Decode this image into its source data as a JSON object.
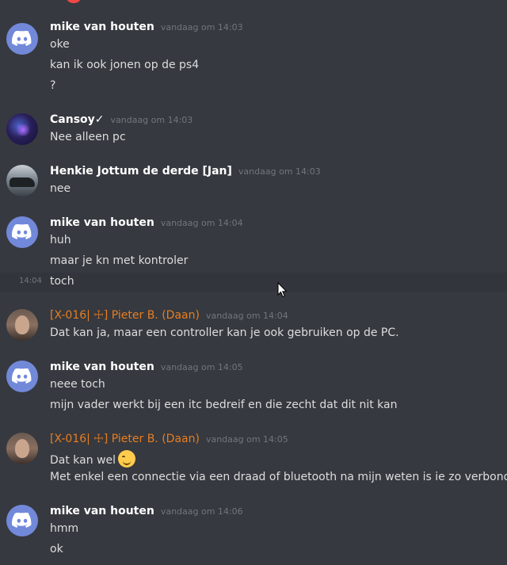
{
  "messages": [
    {
      "author": "mike van houten",
      "timestamp": "vandaag om 14:03",
      "lines": [
        "oke",
        "kan ik ook jonen op de ps4",
        "?"
      ]
    },
    {
      "author": "Cansoy✓",
      "timestamp": "vandaag om 14:03",
      "lines": [
        "Nee alleen pc"
      ]
    },
    {
      "author": "Henkie Jottum de derde [Jan]",
      "timestamp": "vandaag om 14:03",
      "lines": [
        "nee"
      ]
    },
    {
      "author": "mike van houten",
      "timestamp": "vandaag om 14:04",
      "lines": [
        "huh",
        "maar je kn met kontroler",
        "toch"
      ],
      "hover_time": "14:04"
    },
    {
      "author": "[X-016| ☩] Pieter B. (Daan)",
      "timestamp": "vandaag om 14:04",
      "lines": [
        "Dat kan ja, maar een controller kan je ook gebruiken op de PC."
      ]
    },
    {
      "author": "mike van houten",
      "timestamp": "vandaag om 14:05",
      "lines": [
        "neee toch",
        "mijn vader werkt bij een itc bedreif en die zecht dat dit nit kan"
      ]
    },
    {
      "author": "[X-016| ☩] Pieter B. (Daan)",
      "timestamp": "vandaag om 14:05",
      "lines": [
        "Dat kan wel",
        "Met enkel een connectie via een draad of bluetooth na mijn weten is ie zo verbonden"
      ]
    },
    {
      "author": "mike van houten",
      "timestamp": "vandaag om 14:06",
      "lines": [
        "hmm",
        "ok"
      ]
    }
  ],
  "colors": {
    "background": "#36393f",
    "hover_row": "#32353b",
    "username": "#ffffff",
    "role_orange": "#e67e22",
    "timestamp": "#72767d",
    "message_text": "#dcddde",
    "discord_blurple": "#7289da"
  },
  "icons": {
    "default_avatar": "discord-logo-icon",
    "wink_emoji": "winking-face-icon",
    "cursor": "mouse-cursor-icon"
  }
}
